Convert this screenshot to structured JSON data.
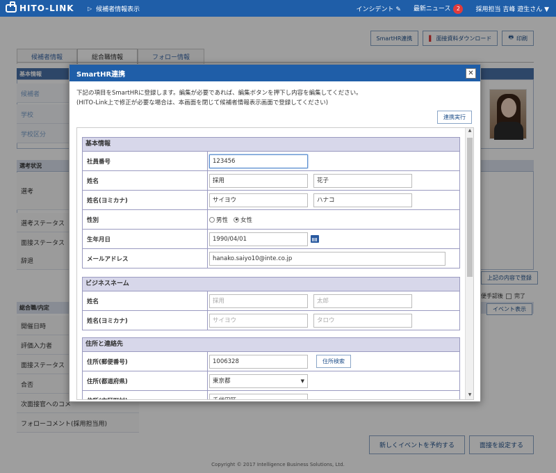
{
  "header": {
    "logo_text": "HITO-LINK",
    "breadcrumb": "候補者情報表示",
    "incident_label": "インシデント",
    "news_label": "最新ニュース",
    "news_count": "2",
    "user_label": "採用担当 吉峰 遊生さん"
  },
  "page": {
    "btn_smarthr": "SmartHR連携",
    "btn_download": "面接資料ダウンロード",
    "btn_print": "印刷",
    "tabs": [
      "候補者情報",
      "総合職情報",
      "フォロー情報"
    ],
    "panel_basic": "基本情報",
    "basic_rows": [
      "候補者",
      "学校",
      "学校区分"
    ],
    "panel_selection": "選考状況",
    "selection_rows": [
      "選考",
      "選考ステータス",
      "面接ステータス",
      "辞退"
    ],
    "btn_register_above": "上記の内容で登録",
    "panel_offer": "総合職/内定",
    "offer_rows": [
      "開催日時",
      "評価入力者",
      "面接ステータス",
      "合否",
      "次面接官へのコメ",
      "フォローコメント(採用担当用)"
    ],
    "filter_text": "便手認後",
    "filter_done": "完了",
    "btn_event_show": "イベント表示",
    "btn_new_event": "新しくイベントを予約する",
    "btn_set_interview": "面接を設定する",
    "copyright": "Copyright © 2017 Intelligence Business Solutions, Ltd."
  },
  "modal": {
    "title": "SmartHR連携",
    "close": "✕",
    "desc_line1": "下記の項目をSmartHRに登録します。編集が必要であれば、編集ボタンを押下し内容を編集してください。",
    "desc_line2": "(HITO-Link上で修正が必要な場合は、本画面を閉じて候補者情報表示画面で登録してください)",
    "exec_button": "連携実行",
    "sections": {
      "basic": {
        "title": "基本情報",
        "employee_no_label": "社員番号",
        "employee_no": "123456",
        "name_label": "姓名",
        "last_name": "採用",
        "first_name": "花子",
        "kana_label": "姓名(ヨミカナ)",
        "last_kana": "サイヨウ",
        "first_kana": "ハナコ",
        "gender_label": "性別",
        "gender_male": "男性",
        "gender_female": "女性",
        "gender_selected": "女性",
        "birthday_label": "生年月日",
        "birthday": "1990/04/01",
        "email_label": "メールアドレス",
        "email": "hanako.saiyo10@inte.co.jp"
      },
      "business": {
        "title": "ビジネスネーム",
        "name_label": "姓名",
        "last_placeholder": "採用",
        "first_placeholder": "太郎",
        "kana_label": "姓名(ヨミカナ)",
        "last_kana_placeholder": "サイヨウ",
        "first_kana_placeholder": "タロウ"
      },
      "address": {
        "title": "住所と連絡先",
        "zip_label": "住所(郵便番号)",
        "zip": "1006328",
        "zip_search": "住所検索",
        "pref_label": "住所(都道府県)",
        "pref": "東京都",
        "city_label": "住所(市区町村)",
        "city": "千代田区"
      }
    }
  }
}
